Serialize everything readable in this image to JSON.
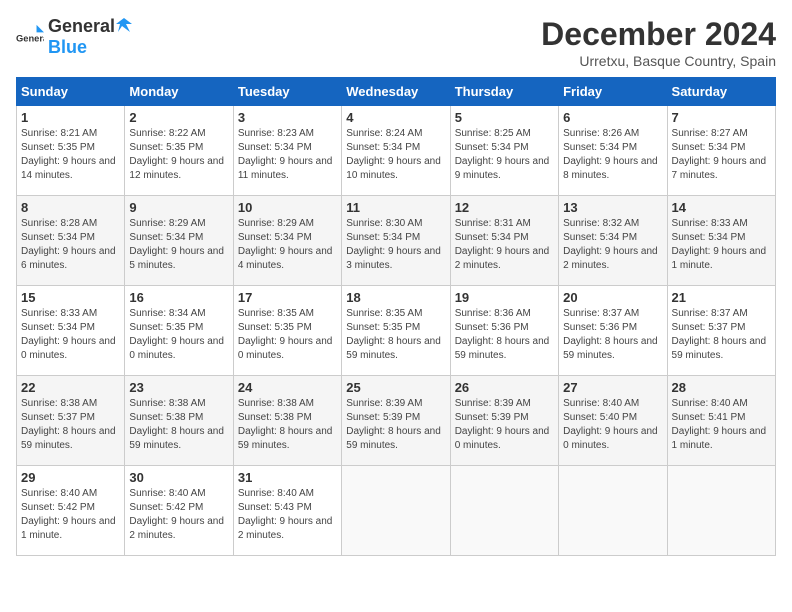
{
  "header": {
    "logo_general": "General",
    "logo_blue": "Blue",
    "title": "December 2024",
    "location": "Urretxu, Basque Country, Spain"
  },
  "days_of_week": [
    "Sunday",
    "Monday",
    "Tuesday",
    "Wednesday",
    "Thursday",
    "Friday",
    "Saturday"
  ],
  "weeks": [
    [
      {
        "day": "1",
        "info": "Sunrise: 8:21 AM\nSunset: 5:35 PM\nDaylight: 9 hours and 14 minutes."
      },
      {
        "day": "2",
        "info": "Sunrise: 8:22 AM\nSunset: 5:35 PM\nDaylight: 9 hours and 12 minutes."
      },
      {
        "day": "3",
        "info": "Sunrise: 8:23 AM\nSunset: 5:34 PM\nDaylight: 9 hours and 11 minutes."
      },
      {
        "day": "4",
        "info": "Sunrise: 8:24 AM\nSunset: 5:34 PM\nDaylight: 9 hours and 10 minutes."
      },
      {
        "day": "5",
        "info": "Sunrise: 8:25 AM\nSunset: 5:34 PM\nDaylight: 9 hours and 9 minutes."
      },
      {
        "day": "6",
        "info": "Sunrise: 8:26 AM\nSunset: 5:34 PM\nDaylight: 9 hours and 8 minutes."
      },
      {
        "day": "7",
        "info": "Sunrise: 8:27 AM\nSunset: 5:34 PM\nDaylight: 9 hours and 7 minutes."
      }
    ],
    [
      {
        "day": "8",
        "info": "Sunrise: 8:28 AM\nSunset: 5:34 PM\nDaylight: 9 hours and 6 minutes."
      },
      {
        "day": "9",
        "info": "Sunrise: 8:29 AM\nSunset: 5:34 PM\nDaylight: 9 hours and 5 minutes."
      },
      {
        "day": "10",
        "info": "Sunrise: 8:29 AM\nSunset: 5:34 PM\nDaylight: 9 hours and 4 minutes."
      },
      {
        "day": "11",
        "info": "Sunrise: 8:30 AM\nSunset: 5:34 PM\nDaylight: 9 hours and 3 minutes."
      },
      {
        "day": "12",
        "info": "Sunrise: 8:31 AM\nSunset: 5:34 PM\nDaylight: 9 hours and 2 minutes."
      },
      {
        "day": "13",
        "info": "Sunrise: 8:32 AM\nSunset: 5:34 PM\nDaylight: 9 hours and 2 minutes."
      },
      {
        "day": "14",
        "info": "Sunrise: 8:33 AM\nSunset: 5:34 PM\nDaylight: 9 hours and 1 minute."
      }
    ],
    [
      {
        "day": "15",
        "info": "Sunrise: 8:33 AM\nSunset: 5:34 PM\nDaylight: 9 hours and 0 minutes."
      },
      {
        "day": "16",
        "info": "Sunrise: 8:34 AM\nSunset: 5:35 PM\nDaylight: 9 hours and 0 minutes."
      },
      {
        "day": "17",
        "info": "Sunrise: 8:35 AM\nSunset: 5:35 PM\nDaylight: 9 hours and 0 minutes."
      },
      {
        "day": "18",
        "info": "Sunrise: 8:35 AM\nSunset: 5:35 PM\nDaylight: 8 hours and 59 minutes."
      },
      {
        "day": "19",
        "info": "Sunrise: 8:36 AM\nSunset: 5:36 PM\nDaylight: 8 hours and 59 minutes."
      },
      {
        "day": "20",
        "info": "Sunrise: 8:37 AM\nSunset: 5:36 PM\nDaylight: 8 hours and 59 minutes."
      },
      {
        "day": "21",
        "info": "Sunrise: 8:37 AM\nSunset: 5:37 PM\nDaylight: 8 hours and 59 minutes."
      }
    ],
    [
      {
        "day": "22",
        "info": "Sunrise: 8:38 AM\nSunset: 5:37 PM\nDaylight: 8 hours and 59 minutes."
      },
      {
        "day": "23",
        "info": "Sunrise: 8:38 AM\nSunset: 5:38 PM\nDaylight: 8 hours and 59 minutes."
      },
      {
        "day": "24",
        "info": "Sunrise: 8:38 AM\nSunset: 5:38 PM\nDaylight: 8 hours and 59 minutes."
      },
      {
        "day": "25",
        "info": "Sunrise: 8:39 AM\nSunset: 5:39 PM\nDaylight: 8 hours and 59 minutes."
      },
      {
        "day": "26",
        "info": "Sunrise: 8:39 AM\nSunset: 5:39 PM\nDaylight: 9 hours and 0 minutes."
      },
      {
        "day": "27",
        "info": "Sunrise: 8:40 AM\nSunset: 5:40 PM\nDaylight: 9 hours and 0 minutes."
      },
      {
        "day": "28",
        "info": "Sunrise: 8:40 AM\nSunset: 5:41 PM\nDaylight: 9 hours and 1 minute."
      }
    ],
    [
      {
        "day": "29",
        "info": "Sunrise: 8:40 AM\nSunset: 5:42 PM\nDaylight: 9 hours and 1 minute."
      },
      {
        "day": "30",
        "info": "Sunrise: 8:40 AM\nSunset: 5:42 PM\nDaylight: 9 hours and 2 minutes."
      },
      {
        "day": "31",
        "info": "Sunrise: 8:40 AM\nSunset: 5:43 PM\nDaylight: 9 hours and 2 minutes."
      },
      {
        "day": "",
        "info": ""
      },
      {
        "day": "",
        "info": ""
      },
      {
        "day": "",
        "info": ""
      },
      {
        "day": "",
        "info": ""
      }
    ]
  ]
}
